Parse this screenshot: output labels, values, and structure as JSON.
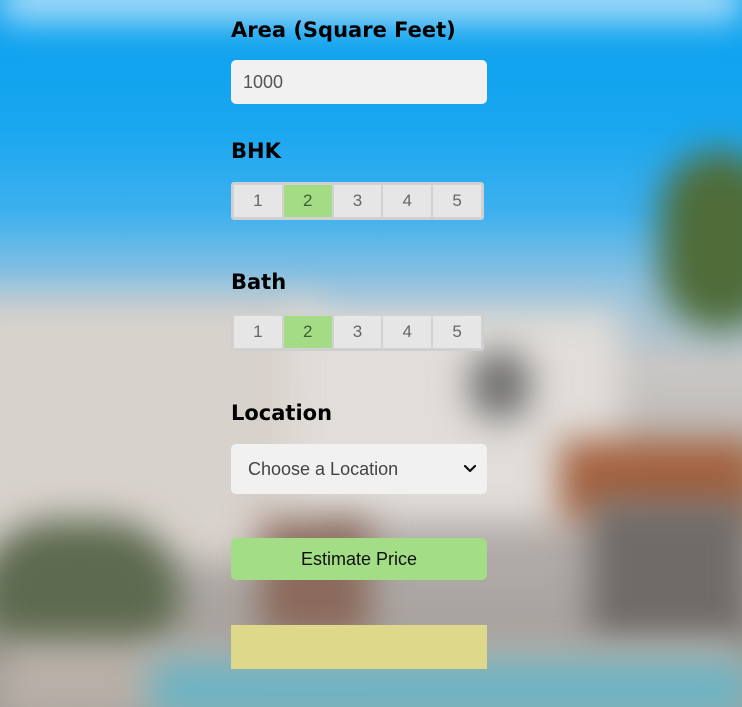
{
  "form": {
    "area": {
      "label": "Area (Square Feet)",
      "value": "1000"
    },
    "bhk": {
      "label": "BHK",
      "options": [
        "1",
        "2",
        "3",
        "4",
        "5"
      ],
      "selected": "2"
    },
    "bath": {
      "label": "Bath",
      "options": [
        "1",
        "2",
        "3",
        "4",
        "5"
      ],
      "selected": "2"
    },
    "location": {
      "label": "Location",
      "placeholder": "Choose a Location"
    },
    "submit_label": "Estimate Price",
    "result_text": ""
  },
  "colors": {
    "selected_option": "#a3dc84",
    "button": "#a3dd85",
    "result_box": "#ddd88a",
    "input_bg": "#f1f1f1"
  },
  "icons": {
    "select_arrow": "chevron-down-icon"
  }
}
